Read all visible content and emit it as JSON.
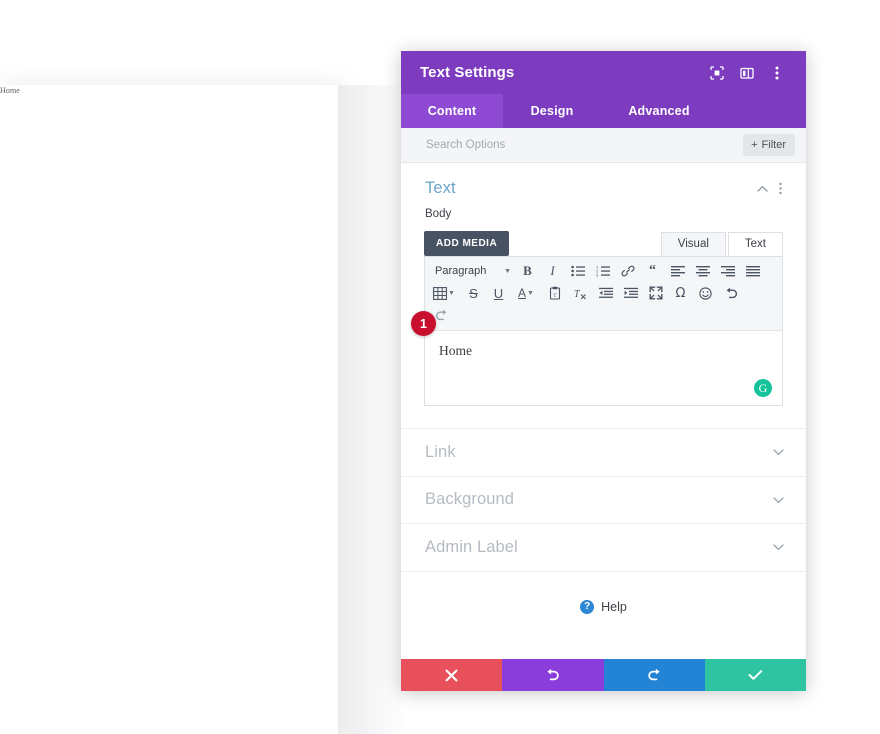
{
  "backdrop": {
    "site_text": "Home"
  },
  "modal": {
    "title": "Text Settings",
    "header_icons": [
      {
        "name": "expand-icon",
        "label": "Expand"
      },
      {
        "name": "layout-columns-icon",
        "label": "Change Layout"
      },
      {
        "name": "more-vertical-icon",
        "label": "More Options"
      }
    ],
    "tabs": [
      {
        "label": "Content",
        "active": true
      },
      {
        "label": "Design",
        "active": false
      },
      {
        "label": "Advanced",
        "active": false
      }
    ],
    "search": {
      "placeholder": "Search Options",
      "value": ""
    },
    "filter_button": {
      "label": "Filter",
      "plus": "+"
    },
    "text_section": {
      "title": "Text",
      "field_label": "Body",
      "add_media_label": "ADD MEDIA",
      "editor_tabs": [
        {
          "label": "Visual",
          "active": true
        },
        {
          "label": "Text",
          "active": false
        }
      ],
      "toolbar": {
        "format_select": "Paragraph",
        "row1": [
          {
            "name": "bold-icon",
            "glyph": "B"
          },
          {
            "name": "italic-icon",
            "glyph": "I"
          },
          {
            "name": "bulleted-list-icon",
            "glyph": ""
          },
          {
            "name": "numbered-list-icon",
            "glyph": ""
          },
          {
            "name": "link-icon",
            "glyph": ""
          },
          {
            "name": "blockquote-icon",
            "glyph": "“"
          },
          {
            "name": "align-left-icon",
            "glyph": ""
          },
          {
            "name": "align-center-icon",
            "glyph": ""
          },
          {
            "name": "align-right-icon",
            "glyph": ""
          },
          {
            "name": "align-justify-icon",
            "glyph": ""
          }
        ],
        "row2": [
          {
            "name": "table-icon",
            "glyph": ""
          },
          {
            "name": "strikethrough-icon",
            "glyph": "S"
          },
          {
            "name": "underline-icon",
            "glyph": "U"
          },
          {
            "name": "text-color-icon",
            "glyph": "A"
          },
          {
            "name": "paste-as-text-icon",
            "glyph": ""
          },
          {
            "name": "clear-formatting-icon",
            "glyph": ""
          },
          {
            "name": "outdent-icon",
            "glyph": ""
          },
          {
            "name": "indent-icon",
            "glyph": ""
          },
          {
            "name": "fullscreen-icon",
            "glyph": ""
          },
          {
            "name": "special-character-icon",
            "glyph": "Ω"
          },
          {
            "name": "emoji-icon",
            "glyph": "☺"
          },
          {
            "name": "undo-icon",
            "glyph": ""
          }
        ],
        "row3": [
          {
            "name": "redo-icon",
            "glyph": ""
          }
        ]
      },
      "content_text": "Home",
      "grammarly_glyph": "G",
      "step_badge": "1"
    },
    "collapsed_sections": [
      {
        "title": "Link"
      },
      {
        "title": "Background"
      },
      {
        "title": "Admin Label"
      }
    ],
    "help": {
      "label": "Help",
      "icon_glyph": "?"
    },
    "footer_buttons": [
      {
        "name": "cancel-button",
        "icon": "close-icon",
        "color": "#e8505b"
      },
      {
        "name": "undo-button",
        "icon": "undo-icon",
        "color": "#8b3ddb"
      },
      {
        "name": "redo-button",
        "icon": "redo-icon",
        "color": "#2383d4"
      },
      {
        "name": "save-button",
        "icon": "check-icon",
        "color": "#2ec4a2"
      }
    ]
  },
  "colors": {
    "header_purple": "#7d3cc0",
    "active_tab_purple": "#8f4ad4",
    "section_title_blue": "#6ba4c8",
    "badge_red": "#c8102e",
    "grammarly_green": "#15c39a"
  }
}
